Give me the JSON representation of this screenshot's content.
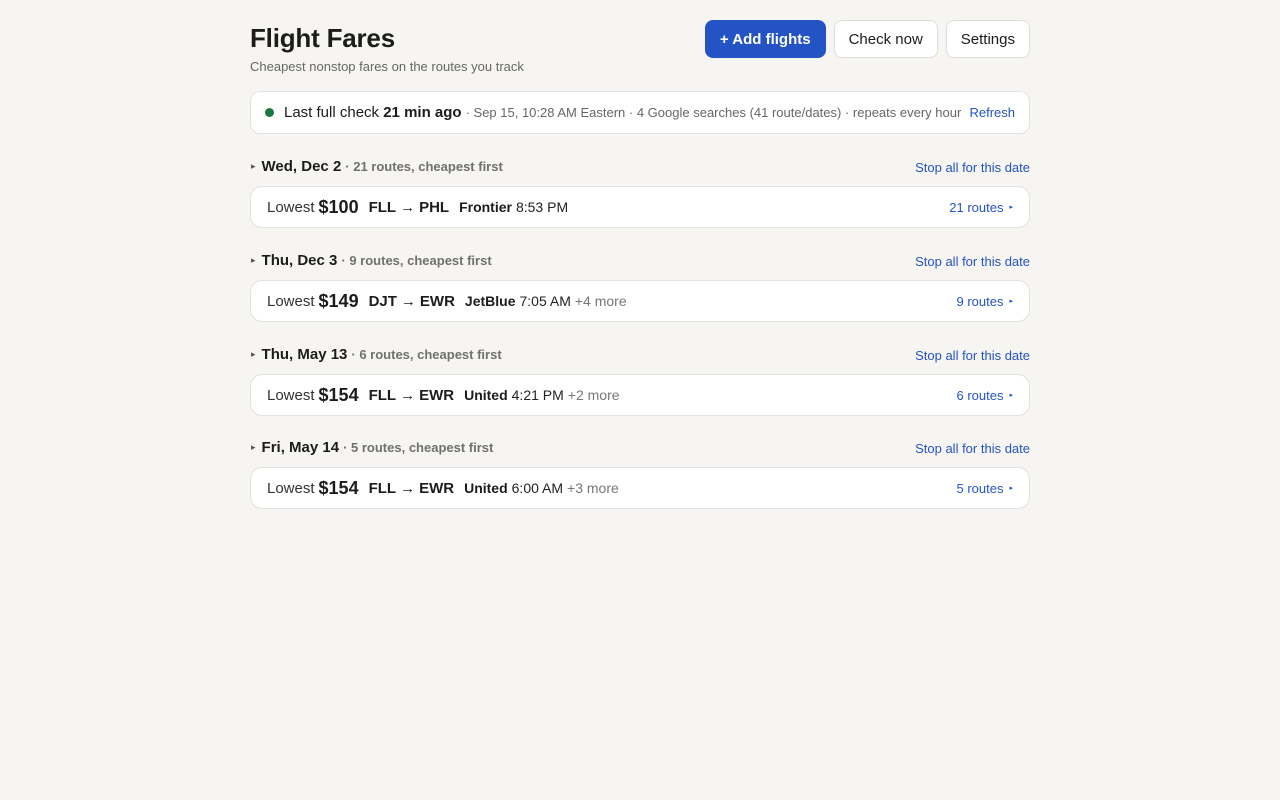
{
  "header": {
    "title": "Flight Fares",
    "subtitle": "Cheapest nonstop fares on the routes you track",
    "add_label": "+ Add flights",
    "check_label": "Check now",
    "settings_label": "Settings"
  },
  "status": {
    "prefix": "Last full check",
    "ago": "21 min ago",
    "meta": "· Sep 15, 10:28 AM Eastern · 4 Google searches (41 route/dates) · repeats every hour",
    "refresh_label": "Refresh",
    "dot_color": "#1a7a3e"
  },
  "common": {
    "stop_label": "Stop all for this date",
    "lowest_label": "Lowest",
    "arrow": "→",
    "caret": "▸"
  },
  "groups": [
    {
      "date": "Wed, Dec 2",
      "meta": "· 21 routes, cheapest first",
      "price": "$100",
      "origin": "FLL",
      "dest": "PHL",
      "airline": "Frontier",
      "time": "8:53 PM",
      "more": "",
      "routes_label": "21 routes"
    },
    {
      "date": "Thu, Dec 3",
      "meta": "· 9 routes, cheapest first",
      "price": "$149",
      "origin": "DJT",
      "dest": "EWR",
      "airline": "JetBlue",
      "time": "7:05 AM",
      "more": "+4 more",
      "routes_label": "9 routes"
    },
    {
      "date": "Thu, May 13",
      "meta": "· 6 routes, cheapest first",
      "price": "$154",
      "origin": "FLL",
      "dest": "EWR",
      "airline": "United",
      "time": "4:21 PM",
      "more": "+2 more",
      "routes_label": "6 routes"
    },
    {
      "date": "Fri, May 14",
      "meta": "· 5 routes, cheapest first",
      "price": "$154",
      "origin": "FLL",
      "dest": "EWR",
      "airline": "United",
      "time": "6:00 AM",
      "more": "+3 more",
      "routes_label": "5 routes"
    }
  ],
  "colors": {
    "accent": "#2453c6",
    "background": "#f6f5f1"
  }
}
